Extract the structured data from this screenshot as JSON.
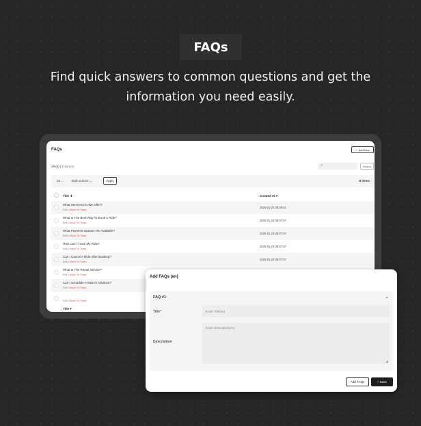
{
  "hero": {
    "badge": "FAQs",
    "subtitle": "Find quick answers to common questions and get the information you need easily."
  },
  "list_screen": {
    "title": "FAQs",
    "add_new_label": "Add New",
    "filter_all": "All (8)",
    "filter_trash": "Trash (0)",
    "search_button": "Search",
    "per_page": "15",
    "bulk_actions": "Bulk actions",
    "apply_label": "Apply",
    "items_count": "8 items",
    "col_title": "Title",
    "col_created": "Created At",
    "footer_col_title": "Title",
    "edit_label": "Edit",
    "trash_label": "Move To Trash",
    "rows": [
      {
        "title": "What Services Do We Offer?",
        "created": "2025-01-23 08:08:51"
      },
      {
        "title": "What Is The Best Way To Book A Ride?",
        "created": "2025-01-23 08:07:57"
      },
      {
        "title": "What Payment Options Are Available?",
        "created": "2025-01-23 08:07:57"
      },
      {
        "title": "How Can I Track My Ride?",
        "created": "2025-01-23 08:07:57"
      },
      {
        "title": "Can I Cancel A Ride After Booking?",
        "created": "2025-01-23 08:07:57"
      },
      {
        "title": "What Is The Rental Service?",
        "created": ""
      },
      {
        "title": "Can I Schedule A Ride In Advance?",
        "created": ""
      },
      {
        "title": "",
        "created": ""
      }
    ]
  },
  "modal": {
    "title": "Add FAQs (en)",
    "faq_header": "FAQ #1",
    "title_label": "Title",
    "required_mark": "*",
    "title_placeholder": "Enter Title(en)",
    "description_label": "Description",
    "description_placeholder": "Enter Description(en)",
    "add_faqs_label": "Add FAQs",
    "save_label": "Save"
  },
  "icons": {
    "add": "plus-icon",
    "search": "search-icon",
    "sort": "sort-icon",
    "chevron": "chevron-down-icon",
    "save": "floppy-disk-icon"
  }
}
